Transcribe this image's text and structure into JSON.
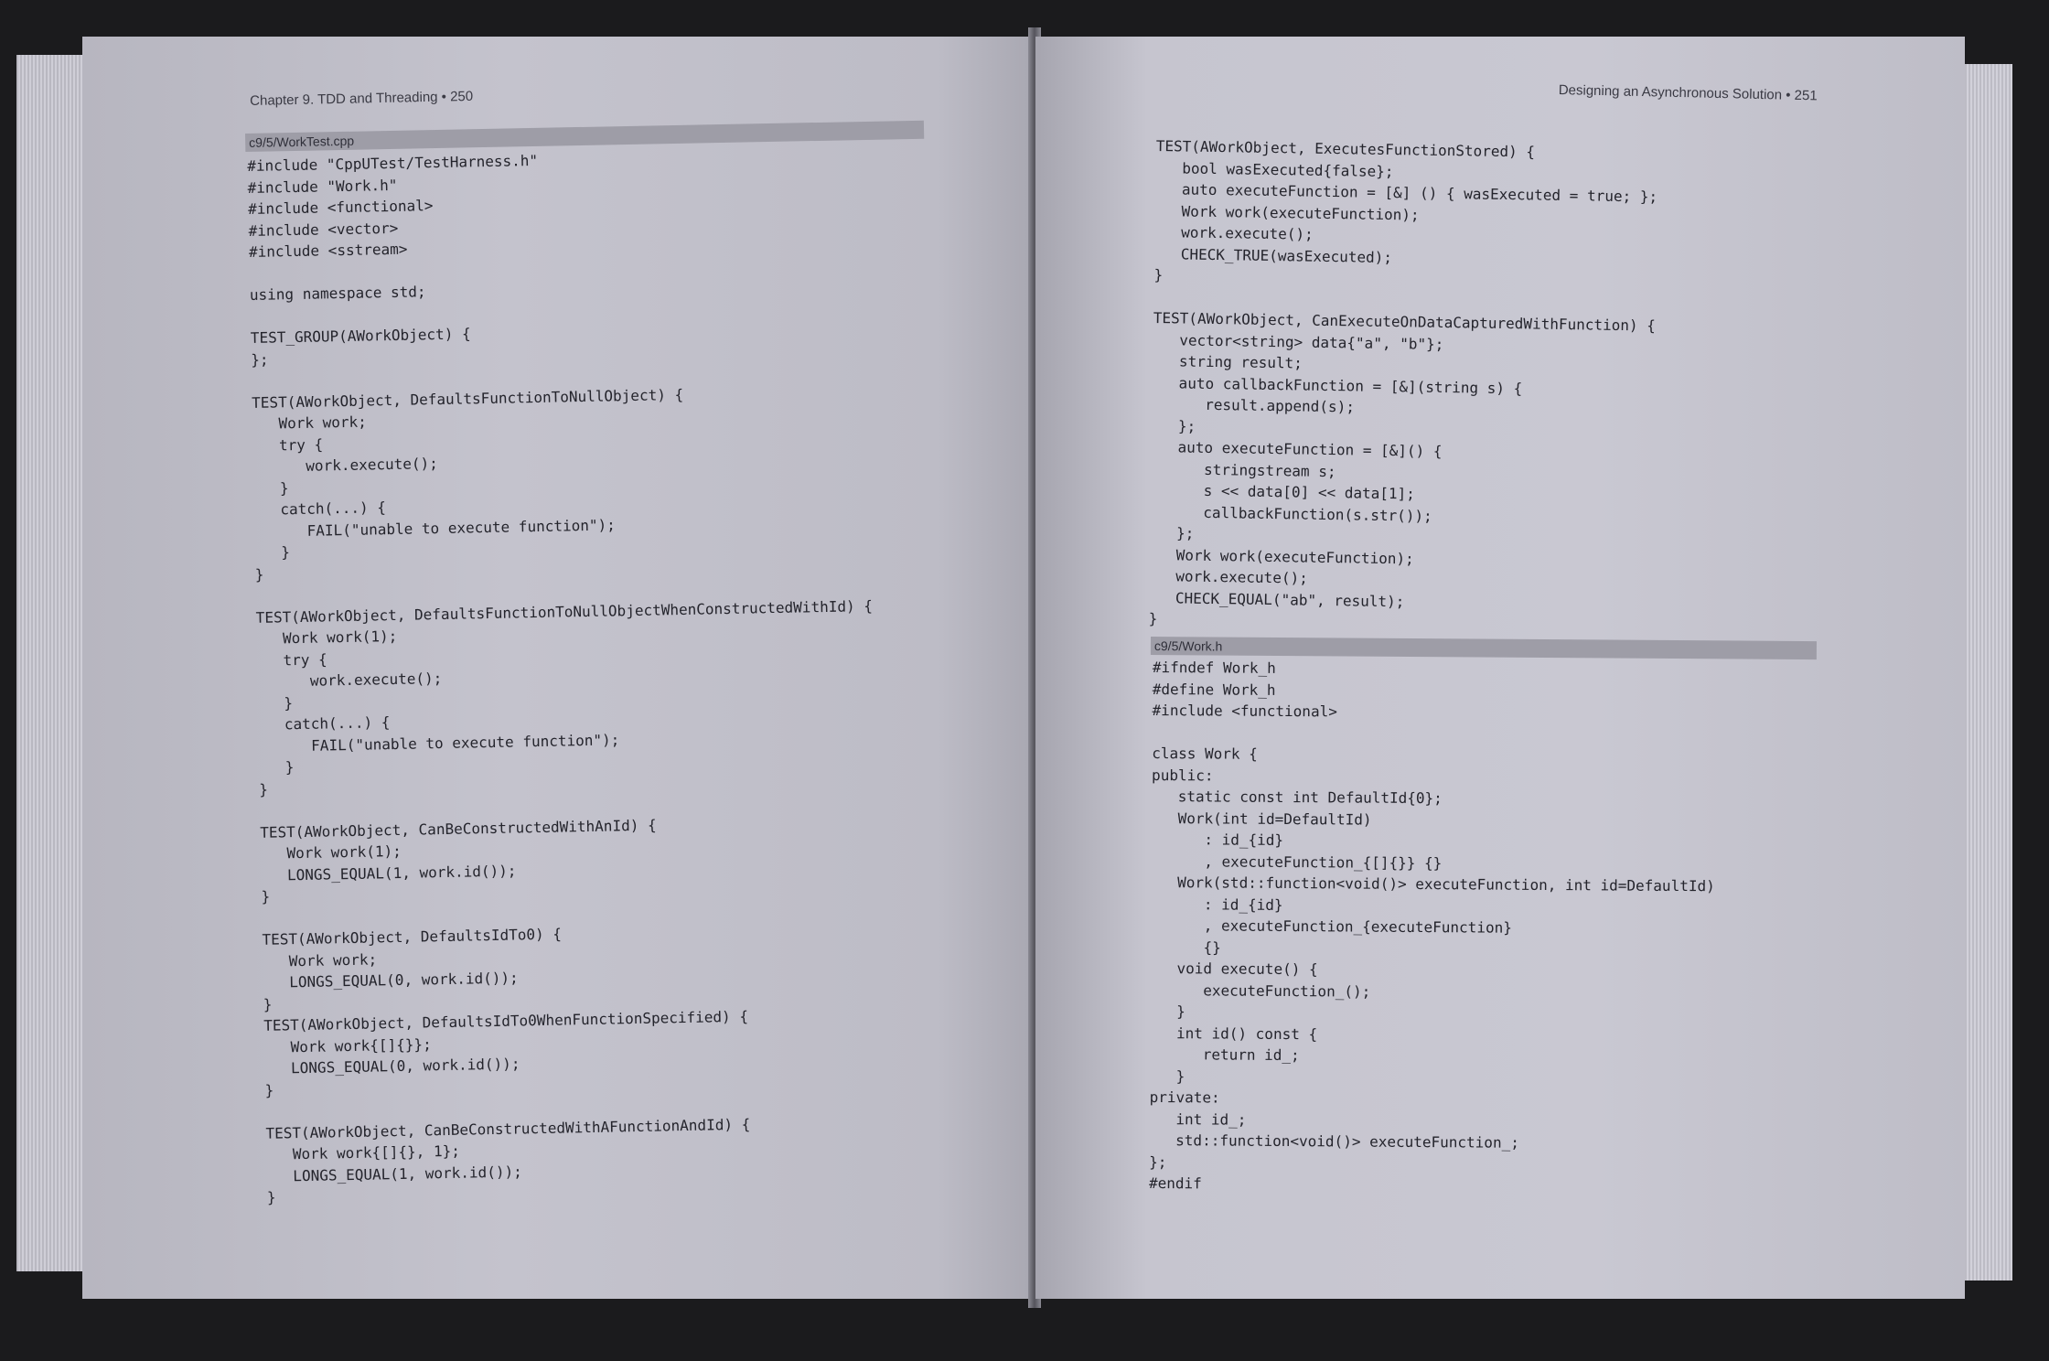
{
  "left_page": {
    "running_head": "Chapter 9. TDD and Threading • 250",
    "listing_label": "c9/5/WorkTest.cpp",
    "code_lines": [
      "#include \"CppUTest/TestHarness.h\"",
      "#include \"Work.h\"",
      "#include <functional>",
      "#include <vector>",
      "#include <sstream>",
      "",
      "using namespace std;",
      "",
      "TEST_GROUP(AWorkObject) {",
      "};",
      "",
      "TEST(AWorkObject, DefaultsFunctionToNullObject) {",
      "   Work work;",
      "   try {",
      "      work.execute();",
      "   }",
      "   catch(...) {",
      "      FAIL(\"unable to execute function\");",
      "   }",
      "}",
      "",
      "TEST(AWorkObject, DefaultsFunctionToNullObjectWhenConstructedWithId) {",
      "   Work work(1);",
      "   try {",
      "      work.execute();",
      "   }",
      "   catch(...) {",
      "      FAIL(\"unable to execute function\");",
      "   }",
      "}",
      "",
      "TEST(AWorkObject, CanBeConstructedWithAnId) {",
      "   Work work(1);",
      "   LONGS_EQUAL(1, work.id());",
      "}",
      "",
      "TEST(AWorkObject, DefaultsIdTo0) {",
      "   Work work;",
      "   LONGS_EQUAL(0, work.id());",
      "}",
      "TEST(AWorkObject, DefaultsIdTo0WhenFunctionSpecified) {",
      "   Work work{[]{}};",
      "   LONGS_EQUAL(0, work.id());",
      "}",
      "",
      "TEST(AWorkObject, CanBeConstructedWithAFunctionAndId) {",
      "   Work work{[]{}, 1};",
      "   LONGS_EQUAL(1, work.id());",
      "}"
    ]
  },
  "right_page": {
    "running_head": "Designing an Asynchronous Solution • 251",
    "code_lines_top": [
      "TEST(AWorkObject, ExecutesFunctionStored) {",
      "   bool wasExecuted{false};",
      "   auto executeFunction = [&] () { wasExecuted = true; };",
      "   Work work(executeFunction);",
      "   work.execute();",
      "   CHECK_TRUE(wasExecuted);",
      "}",
      "",
      "TEST(AWorkObject, CanExecuteOnDataCapturedWithFunction) {",
      "   vector<string> data{\"a\", \"b\"};",
      "   string result;",
      "   auto callbackFunction = [&](string s) {",
      "      result.append(s);",
      "   };",
      "   auto executeFunction = [&]() {",
      "      stringstream s;",
      "      s << data[0] << data[1];",
      "      callbackFunction(s.str());",
      "   };",
      "   Work work(executeFunction);",
      "   work.execute();",
      "   CHECK_EQUAL(\"ab\", result);",
      "}"
    ],
    "listing_label": "c9/5/Work.h",
    "code_lines_bottom": [
      "#ifndef Work_h",
      "#define Work_h",
      "#include <functional>",
      "",
      "class Work {",
      "public:",
      "   static const int DefaultId{0};",
      "   Work(int id=DefaultId)",
      "      : id_{id}",
      "      , executeFunction_{[]{}} {}",
      "   Work(std::function<void()> executeFunction, int id=DefaultId)",
      "      : id_{id}",
      "      , executeFunction_{executeFunction}",
      "      {}",
      "   void execute() {",
      "      executeFunction_();",
      "   }",
      "   int id() const {",
      "      return id_;",
      "   }",
      "private:",
      "   int id_;",
      "   std::function<void()> executeFunction_;",
      "};",
      "#endif"
    ]
  }
}
